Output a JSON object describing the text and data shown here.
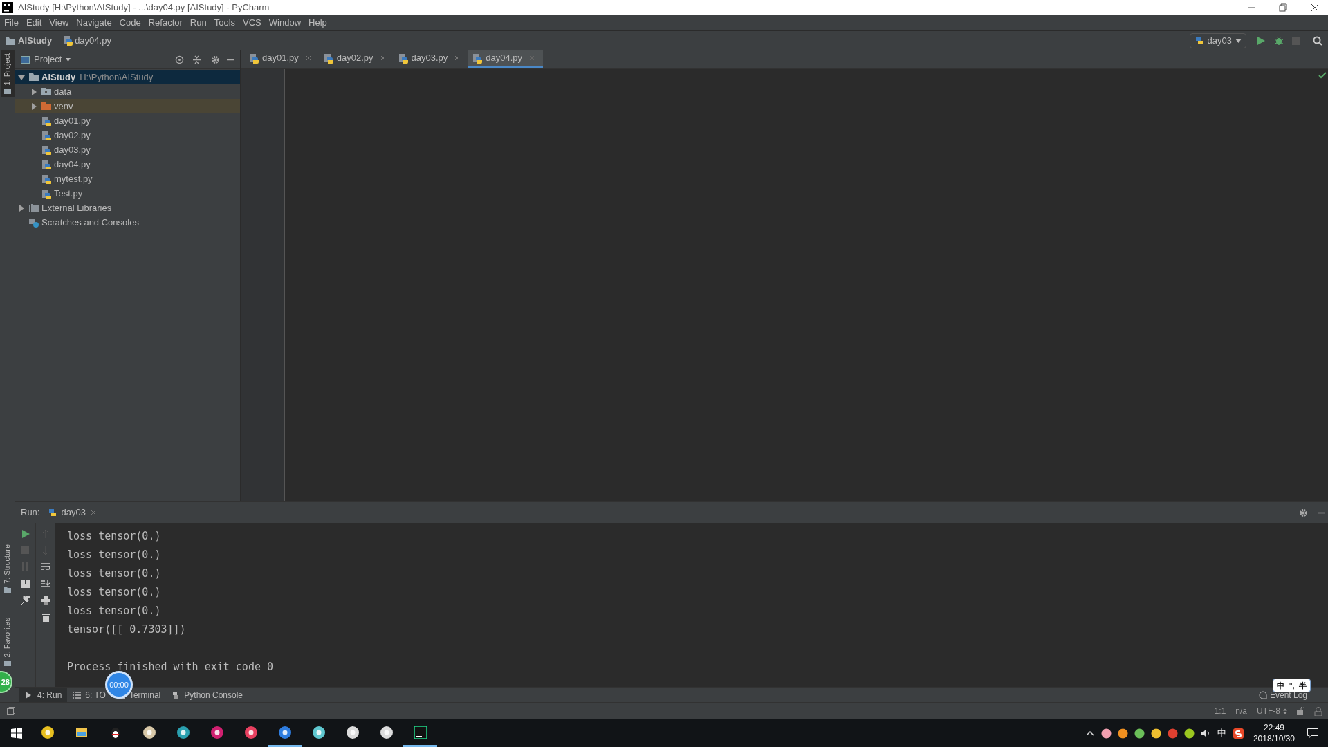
{
  "window": {
    "title": "AIStudy [H:\\Python\\AIStudy] - ...\\day04.py [AIStudy] - PyCharm"
  },
  "menu": [
    "File",
    "Edit",
    "View",
    "Navigate",
    "Code",
    "Refactor",
    "Run",
    "Tools",
    "VCS",
    "Window",
    "Help"
  ],
  "breadcrumb": [
    "AIStudy",
    "day04.py"
  ],
  "run_config": "day03",
  "side_tabs": [
    {
      "label": "1: Project",
      "selected": true
    },
    {
      "label": "7: Structure",
      "selected": false
    },
    {
      "label": "2: Favorites",
      "selected": false
    }
  ],
  "project_panel": {
    "title": "Project",
    "tree": [
      {
        "kind": "project",
        "label": "AIStudy",
        "path": "H:\\Python\\AIStudy",
        "selected": true,
        "expanded": true,
        "children": [
          {
            "kind": "folder",
            "label": "data",
            "selected": false,
            "expanded": false
          },
          {
            "kind": "excluded",
            "label": "venv",
            "selected": false,
            "expanded": false
          },
          {
            "kind": "python",
            "label": "day01.py",
            "selected": false
          },
          {
            "kind": "python",
            "label": "day02.py",
            "selected": false
          },
          {
            "kind": "python",
            "label": "day03.py",
            "selected": false
          },
          {
            "kind": "python",
            "label": "day04.py",
            "selected": false
          },
          {
            "kind": "python",
            "label": "mytest.py",
            "selected": false
          },
          {
            "kind": "python",
            "label": "Test.py",
            "selected": false
          }
        ]
      },
      {
        "kind": "libraries",
        "label": "External Libraries",
        "selected": false,
        "expanded": false
      },
      {
        "kind": "scratches",
        "label": "Scratches and Consoles",
        "selected": false
      }
    ]
  },
  "editor_tabs": [
    {
      "label": "day01.py",
      "selected": false
    },
    {
      "label": "day02.py",
      "selected": false
    },
    {
      "label": "day03.py",
      "selected": false
    },
    {
      "label": "day04.py",
      "selected": true
    }
  ],
  "run_panel": {
    "label": "Run:",
    "tab": "day03",
    "output": [
      "loss tensor(0.)",
      "loss tensor(0.)",
      "loss tensor(0.)",
      "loss tensor(0.)",
      "loss tensor(0.)",
      "tensor([[ 0.7303]])"
    ],
    "exit_message": "Process finished with exit code 0"
  },
  "tool_tabs": [
    {
      "label": "4: Run",
      "selected": true
    },
    {
      "label": "6: TO",
      "selected": false
    },
    {
      "label": "Terminal",
      "selected": false
    },
    {
      "label": "Python Console",
      "selected": false
    }
  ],
  "event_log": "Event Log",
  "status_bar": {
    "position": "1:1",
    "line_separator": "n/a",
    "encoding": "UTF-8"
  },
  "overlays": {
    "timer": "00:00",
    "badge": "28",
    "ime": [
      "中",
      "°,",
      "半"
    ]
  },
  "taskbar": {
    "apps": [
      {
        "running": false
      },
      {
        "running": false
      },
      {
        "running": false
      },
      {
        "running": false
      },
      {
        "running": false
      },
      {
        "running": false
      },
      {
        "running": false
      },
      {
        "running": true
      },
      {
        "running": false
      },
      {
        "running": false
      },
      {
        "running": false
      },
      {
        "running": true
      }
    ],
    "input_method": "中",
    "time": "22:49",
    "date": "2018/10/30"
  }
}
